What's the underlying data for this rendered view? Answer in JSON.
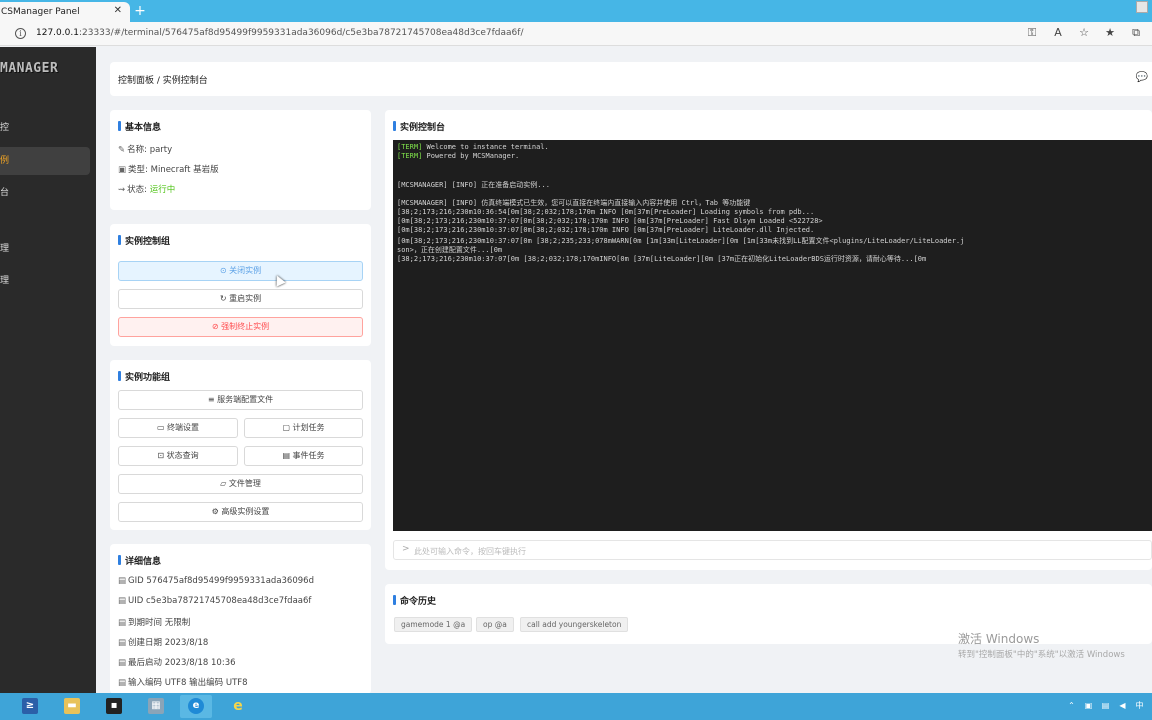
{
  "browser": {
    "tab_title": "CSManager Panel",
    "url_host": "127.0.0.1",
    "url_rest": ":23333/#/terminal/576475af8d95499f9959331ada36096d/c5e3ba78721745708ea48d3ce7fdaa6f/"
  },
  "sidebar": {
    "logo": "MANAGER",
    "items": [
      {
        "label": "控"
      },
      {
        "label": "例"
      },
      {
        "label": "台"
      },
      {
        "label": "理"
      },
      {
        "label": "理"
      }
    ]
  },
  "header": {
    "breadcrumb": "控制面板 / 实例控制台"
  },
  "basic_info": {
    "title": "基本信息",
    "name_label": "名称:",
    "name_value": "party",
    "type_label": "类型:",
    "type_value": "Minecraft 基岩版",
    "status_label": "状态:",
    "status_value": "运行中",
    "status_color": "#52c41a"
  },
  "control_group": {
    "title": "实例控制组",
    "stop_label": "关闭实例",
    "restart_label": "重启实例",
    "kill_label": "强制终止实例"
  },
  "function_group": {
    "title": "实例功能组",
    "server_config": "服务端配置文件",
    "terminal_settings": "终端设置",
    "scheduled_tasks": "计划任务",
    "status_query": "状态查询",
    "event_tasks": "事件任务",
    "file_manager": "文件管理",
    "advanced_settings": "高级实例设置"
  },
  "details": {
    "title": "详细信息",
    "gid": "GID 576475af8d95499f9959331ada36096d",
    "uid": "UID c5e3ba78721745708ea48d3ce7fdaa6f",
    "expire": "到期时间  无限制",
    "created": "创建日期  2023/8/18",
    "last_start": "最后启动  2023/8/18 10:36",
    "encoding": "输入编码  UTF8 输出编码  UTF8"
  },
  "console": {
    "title": "实例控制台",
    "lines": [
      {
        "tag": "[TERM]",
        "text": " Welcome to instance terminal."
      },
      {
        "tag": "[TERM]",
        "text": " Powered by MCSManager."
      },
      {
        "tag": "",
        "text": "[MCSMANAGER] [INFO] 正在准备启动实例..."
      },
      {
        "tag": "",
        "text": "[MCSMANAGER] [INFO] 仿真终端模式已生效，您可以直接在终端内直接输入内容并使用 Ctrl，Tab 等功能键"
      },
      {
        "tag": "",
        "text": "[38;2;173;216;230m10:36:54[0m[38;2;032;178;170m INFO [0m[37m[PreLoader] Loading symbols from pdb..."
      },
      {
        "tag": "",
        "text": "[0m[38;2;173;216;230m10:37:07[0m[38;2;032;178;170m INFO [0m[37m[PreLoader] Fast Dlsym Loaded <522728>"
      },
      {
        "tag": "",
        "text": "[0m[38;2;173;216;230m10:37:07[0m[38;2;032;178;170m INFO [0m[37m[PreLoader] LiteLoader.dll Injected."
      },
      {
        "tag": "",
        "text": "[0m[38;2;173;216;230m10:37:07[0m [38;2;235;233;078mWARN[0m [1m[33m[LiteLoader][0m [1m[33m未找到LL配置文件<plugins/LiteLoader/LiteLoader.j"
      },
      {
        "tag": "",
        "text": "son>，正在创建配置文件...[0m"
      },
      {
        "tag": "",
        "text": "[38;2;173;216;230m10:37:07[0m [38;2;032;178;170mINFO[0m [37m[LiteLoader][0m [37m正在初始化LiteLoaderBDS运行时资源，请耐心等待...[0m"
      }
    ],
    "input_prompt": ">",
    "input_placeholder": "此处可输入命令，按回车键执行"
  },
  "history": {
    "title": "命令历史",
    "items": [
      "gamemode 1 @a",
      "op @a",
      "call add youngerskeleton"
    ]
  },
  "watermark": {
    "line1": "激活 Windows",
    "line2": "转到\"控制面板\"中的\"系统\"以激活 Windows"
  }
}
